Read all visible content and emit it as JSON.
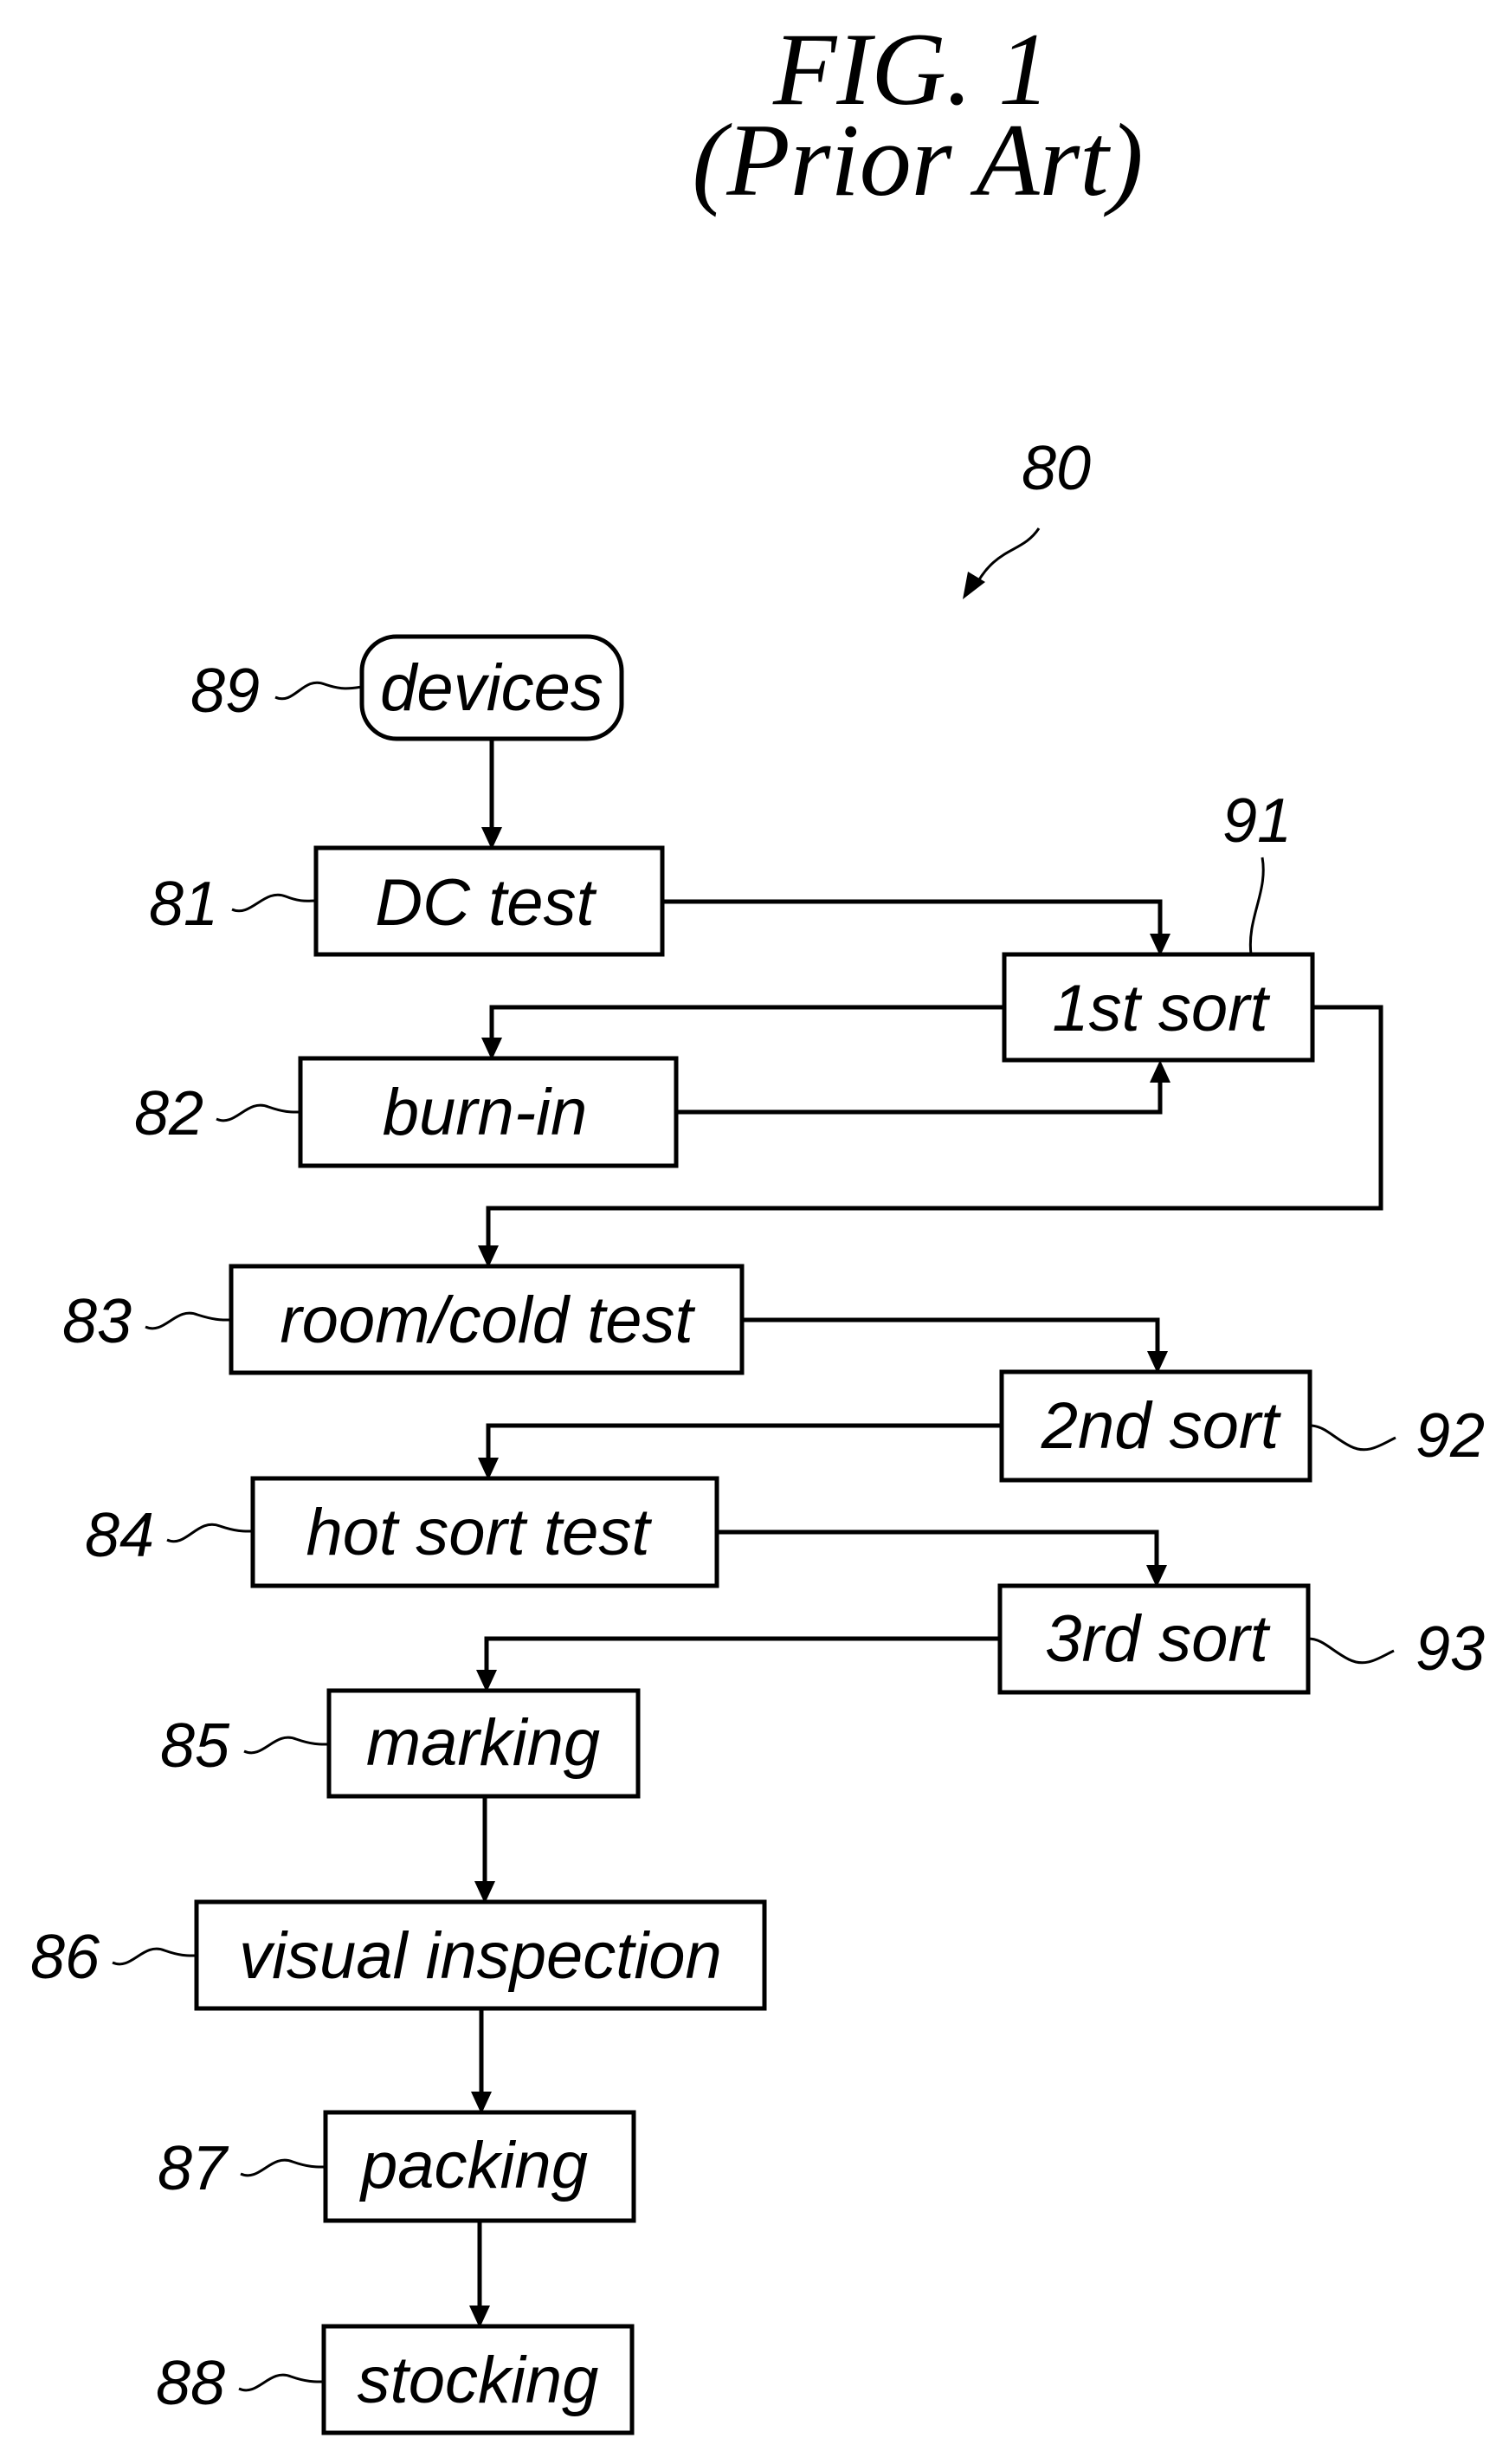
{
  "figure": {
    "title": "FIG. 1",
    "subtitle": "(Prior Art)",
    "reference": "80"
  },
  "nodes": [
    {
      "id": "devices",
      "label": "devices",
      "ref": "89",
      "shape": "rounded"
    },
    {
      "id": "dc_test",
      "label": "DC test",
      "ref": "81",
      "shape": "rect"
    },
    {
      "id": "sort1",
      "label": "1st sort",
      "ref": "91",
      "shape": "rect"
    },
    {
      "id": "burn_in",
      "label": "burn-in",
      "ref": "82",
      "shape": "rect"
    },
    {
      "id": "room_cold",
      "label": "room/cold test",
      "ref": "83",
      "shape": "rect"
    },
    {
      "id": "sort2",
      "label": "2nd sort",
      "ref": "92",
      "shape": "rect"
    },
    {
      "id": "hot_sort",
      "label": "hot sort test",
      "ref": "84",
      "shape": "rect"
    },
    {
      "id": "sort3",
      "label": "3rd sort",
      "ref": "93",
      "shape": "rect"
    },
    {
      "id": "marking",
      "label": "marking",
      "ref": "85",
      "shape": "rect"
    },
    {
      "id": "visual",
      "label": "visual inspection",
      "ref": "86",
      "shape": "rect"
    },
    {
      "id": "packing",
      "label": "packing",
      "ref": "87",
      "shape": "rect"
    },
    {
      "id": "stocking",
      "label": "stocking",
      "ref": "88",
      "shape": "rect"
    }
  ],
  "edges": [
    {
      "from": "devices",
      "to": "dc_test"
    },
    {
      "from": "dc_test",
      "to": "sort1"
    },
    {
      "from": "sort1",
      "to": "burn_in"
    },
    {
      "from": "burn_in",
      "to": "sort1"
    },
    {
      "from": "sort1",
      "to": "room_cold"
    },
    {
      "from": "room_cold",
      "to": "sort2"
    },
    {
      "from": "sort2",
      "to": "hot_sort"
    },
    {
      "from": "hot_sort",
      "to": "sort3"
    },
    {
      "from": "sort3",
      "to": "marking"
    },
    {
      "from": "marking",
      "to": "visual"
    },
    {
      "from": "visual",
      "to": "packing"
    },
    {
      "from": "packing",
      "to": "stocking"
    }
  ]
}
